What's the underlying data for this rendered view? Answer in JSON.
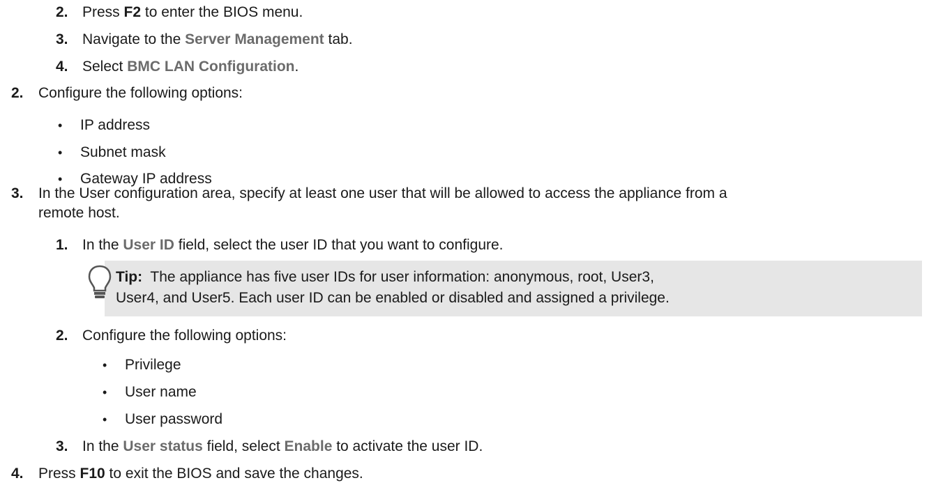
{
  "steps": {
    "sub_2_num": "2.",
    "sub_2_a": "Press ",
    "sub_2_key": "F2",
    "sub_2_b": " to enter the BIOS menu.",
    "sub_3_num": "3.",
    "sub_3_a": "Navigate to the ",
    "sub_3_ui": "Server Management",
    "sub_3_b": " tab.",
    "sub_4_num": "4.",
    "sub_4_a": "Select ",
    "sub_4_ui": "BMC LAN Configuration",
    "sub_4_b": ".",
    "step_2_num": "2.",
    "step_2_text": "Configure the following options:",
    "step_2_options": [
      "IP address",
      "Subnet mask",
      "Gateway IP address"
    ],
    "step_3_num": "3.",
    "step_3_line1": "In the User configuration area, specify at least one user that will be allowed to access the appliance from a",
    "step_3_line2": "remote host.",
    "s3_1_num": "1.",
    "s3_1_a": "In the ",
    "s3_1_ui": "User ID",
    "s3_1_b": " field, select the user ID that you want to configure.",
    "tip_label": "Tip:",
    "tip_line1": "  The appliance has five user IDs for user information: anonymous, root, User3,",
    "tip_line2": "User4, and User5. Each user ID can be enabled or disabled and assigned a privilege.",
    "s3_2_num": "2.",
    "s3_2_text": "Configure the following options:",
    "s3_2_options": [
      "Privilege",
      "User name",
      "User password"
    ],
    "s3_3_num": "3.",
    "s3_3_a": "In the ",
    "s3_3_ui1": "User status",
    "s3_3_b": " field, select ",
    "s3_3_ui2": "Enable",
    "s3_3_c": " to activate the user ID.",
    "step_4_num": "4.",
    "step_4_a": "Press ",
    "step_4_key": "F10",
    "step_4_b": " to exit the BIOS and save the changes."
  },
  "bullet_char": "•",
  "icons": {
    "tip": "lightbulb-icon"
  }
}
